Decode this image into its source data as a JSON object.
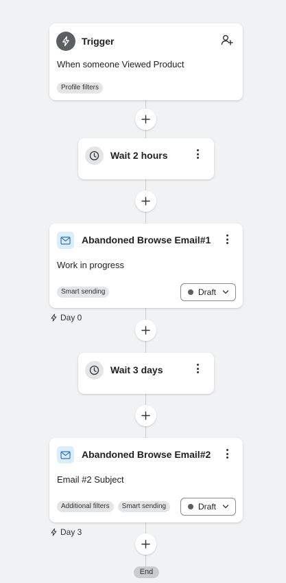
{
  "trigger": {
    "title": "Trigger",
    "description": "When someone Viewed Product",
    "tags": [
      "Profile filters"
    ],
    "icons": {
      "main": "lightning-icon",
      "action": "add-person-icon"
    }
  },
  "wait1": {
    "title": "Wait 2 hours"
  },
  "email1": {
    "title": "Abandoned Browse Email#1",
    "subject": "Work in progress",
    "tags": [
      "Smart sending"
    ],
    "status": "Draft",
    "day": "Day 0"
  },
  "wait2": {
    "title": "Wait 3 days"
  },
  "email2": {
    "title": "Abandoned Browse Email#2",
    "subject": "Email #2 Subject",
    "tags": [
      "Additional filters",
      "Smart sending"
    ],
    "status": "Draft",
    "day": "Day 3"
  },
  "end": {
    "label": "End"
  },
  "colors": {
    "background": "#f1f2f3",
    "card": "#ffffff",
    "icon_dark": "#5c5f62",
    "mail_tint": "#dbeefb"
  }
}
